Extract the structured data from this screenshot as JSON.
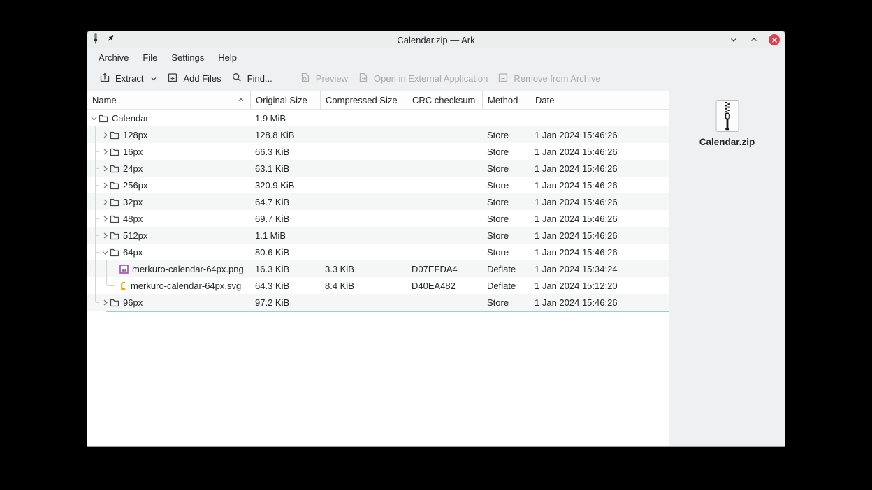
{
  "window": {
    "title": "Calendar.zip — Ark",
    "controls": {
      "minimize": "chevron-down",
      "maximize": "chevron-up",
      "close": "x"
    }
  },
  "menu": {
    "items": [
      "Archive",
      "File",
      "Settings",
      "Help"
    ]
  },
  "toolbar": {
    "extract_label": "Extract",
    "add_files_label": "Add Files",
    "find_label": "Find...",
    "preview_label": "Preview",
    "open_external_label": "Open in External Application",
    "remove_label": "Remove from Archive"
  },
  "table": {
    "columns": [
      "Name",
      "Original Size",
      "Compressed Size",
      "CRC checksum",
      "Method",
      "Date"
    ],
    "rows": [
      {
        "depth": 0,
        "kind": "folder",
        "expanded": true,
        "name": "Calendar",
        "original_size": "1.9 MiB",
        "compressed_size": "",
        "crc": "",
        "method": "",
        "date": ""
      },
      {
        "depth": 1,
        "kind": "folder",
        "expanded": false,
        "name": "128px",
        "original_size": "128.8 KiB",
        "compressed_size": "",
        "crc": "",
        "method": "Store",
        "date": "1 Jan 2024 15:46:26"
      },
      {
        "depth": 1,
        "kind": "folder",
        "expanded": false,
        "name": "16px",
        "original_size": "66.3 KiB",
        "compressed_size": "",
        "crc": "",
        "method": "Store",
        "date": "1 Jan 2024 15:46:26"
      },
      {
        "depth": 1,
        "kind": "folder",
        "expanded": false,
        "name": "24px",
        "original_size": "63.1 KiB",
        "compressed_size": "",
        "crc": "",
        "method": "Store",
        "date": "1 Jan 2024 15:46:26"
      },
      {
        "depth": 1,
        "kind": "folder",
        "expanded": false,
        "name": "256px",
        "original_size": "320.9 KiB",
        "compressed_size": "",
        "crc": "",
        "method": "Store",
        "date": "1 Jan 2024 15:46:26"
      },
      {
        "depth": 1,
        "kind": "folder",
        "expanded": false,
        "name": "32px",
        "original_size": "64.7 KiB",
        "compressed_size": "",
        "crc": "",
        "method": "Store",
        "date": "1 Jan 2024 15:46:26"
      },
      {
        "depth": 1,
        "kind": "folder",
        "expanded": false,
        "name": "48px",
        "original_size": "69.7 KiB",
        "compressed_size": "",
        "crc": "",
        "method": "Store",
        "date": "1 Jan 2024 15:46:26"
      },
      {
        "depth": 1,
        "kind": "folder",
        "expanded": false,
        "name": "512px",
        "original_size": "1.1 MiB",
        "compressed_size": "",
        "crc": "",
        "method": "Store",
        "date": "1 Jan 2024 15:46:26"
      },
      {
        "depth": 1,
        "kind": "folder",
        "expanded": true,
        "name": "64px",
        "original_size": "80.6 KiB",
        "compressed_size": "",
        "crc": "",
        "method": "Store",
        "date": "1 Jan 2024 15:46:26"
      },
      {
        "depth": 2,
        "kind": "png",
        "expanded": null,
        "name": "merkuro-calendar-64px.png",
        "original_size": "16.3 KiB",
        "compressed_size": "3.3 KiB",
        "crc": "D07EFDA4",
        "method": "Deflate",
        "date": "1 Jan 2024 15:34:24"
      },
      {
        "depth": 2,
        "kind": "svg",
        "expanded": null,
        "name": "merkuro-calendar-64px.svg",
        "original_size": "64.3 KiB",
        "compressed_size": "8.4 KiB",
        "crc": "D40EA482",
        "method": "Deflate",
        "date": "1 Jan 2024 15:12:20"
      },
      {
        "depth": 1,
        "kind": "folder",
        "expanded": false,
        "name": "96px",
        "original_size": "97.2 KiB",
        "compressed_size": "",
        "crc": "",
        "method": "Store",
        "date": "1 Jan 2024 15:46:26"
      }
    ]
  },
  "panel": {
    "archive_name": "Calendar.zip"
  },
  "colors": {
    "chrome_bg": "#eff0f1",
    "view_bg": "#ffffff",
    "alt_row": "#f5f6f6",
    "text": "#232629",
    "disabled_text": "#a9abad",
    "close_red": "#d6454f",
    "drop_indicator_blue": "#8fd0ee",
    "png_icon_purple": "#9b59b6",
    "svg_icon_orange": "#f3a20a"
  }
}
